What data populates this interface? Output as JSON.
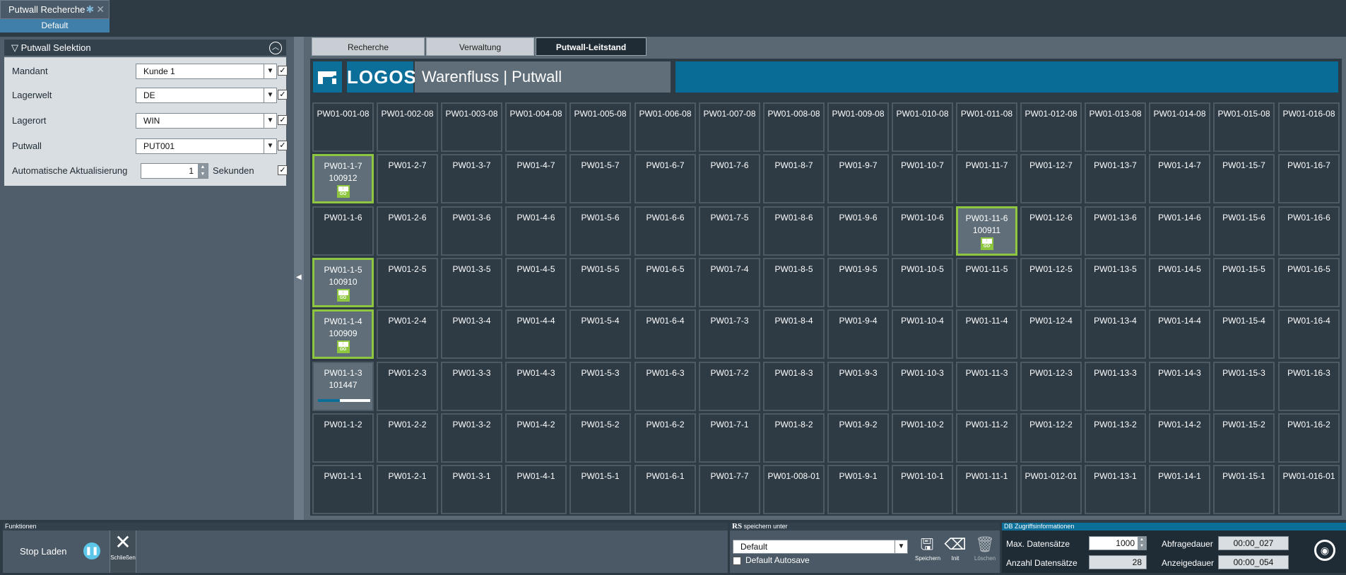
{
  "window": {
    "tab_title": "Putwall Recherche",
    "subtab": "Default"
  },
  "sidebar": {
    "header": "Putwall Selektion",
    "fields": [
      {
        "label": "Mandant",
        "value": "Kunde 1",
        "checked": true
      },
      {
        "label": "Lagerwelt",
        "value": "DE",
        "checked": true
      },
      {
        "label": "Lagerort",
        "value": "WIN",
        "checked": true
      },
      {
        "label": "Putwall",
        "value": "PUT001",
        "checked": true
      }
    ],
    "auto_update": {
      "label": "Automatische Aktualisierung",
      "value": "1",
      "unit": "Sekunden",
      "checked": true
    }
  },
  "main": {
    "tabs": [
      {
        "label": "Recherche",
        "active": false
      },
      {
        "label": "Verwaltung",
        "active": false
      },
      {
        "label": "Putwall-Leitstand",
        "active": true
      }
    ],
    "logo_text": "LOGOS",
    "title": "Warenfluss | Putwall",
    "grid": [
      [
        "PW01-001-08",
        "PW01-002-08",
        "PW01-003-08",
        "PW01-004-08",
        "PW01-005-08",
        "PW01-006-08",
        "PW01-007-08",
        "PW01-008-08",
        "PW01-009-08",
        "PW01-010-08",
        "PW01-011-08",
        "PW01-012-08",
        "PW01-013-08",
        "PW01-014-08",
        "PW01-015-08",
        "PW01-016-08"
      ],
      [
        "PW01-1-7",
        "PW01-2-7",
        "PW01-3-7",
        "PW01-4-7",
        "PW01-5-7",
        "PW01-6-7",
        "PW01-7-6",
        "PW01-8-7",
        "PW01-9-7",
        "PW01-10-7",
        "PW01-11-7",
        "PW01-12-7",
        "PW01-13-7",
        "PW01-14-7",
        "PW01-15-7",
        "PW01-16-7"
      ],
      [
        "PW01-1-6",
        "PW01-2-6",
        "PW01-3-6",
        "PW01-4-6",
        "PW01-5-6",
        "PW01-6-6",
        "PW01-7-5",
        "PW01-8-6",
        "PW01-9-6",
        "PW01-10-6",
        "PW01-11-6",
        "PW01-12-6",
        "PW01-13-6",
        "PW01-14-6",
        "PW01-15-6",
        "PW01-16-6"
      ],
      [
        "PW01-1-5",
        "PW01-2-5",
        "PW01-3-5",
        "PW01-4-5",
        "PW01-5-5",
        "PW01-6-5",
        "PW01-7-4",
        "PW01-8-5",
        "PW01-9-5",
        "PW01-10-5",
        "PW01-11-5",
        "PW01-12-5",
        "PW01-13-5",
        "PW01-14-5",
        "PW01-15-5",
        "PW01-16-5"
      ],
      [
        "PW01-1-4",
        "PW01-2-4",
        "PW01-3-4",
        "PW01-4-4",
        "PW01-5-4",
        "PW01-6-4",
        "PW01-7-3",
        "PW01-8-4",
        "PW01-9-4",
        "PW01-10-4",
        "PW01-11-4",
        "PW01-12-4",
        "PW01-13-4",
        "PW01-14-4",
        "PW01-15-4",
        "PW01-16-4"
      ],
      [
        "PW01-1-3",
        "PW01-2-3",
        "PW01-3-3",
        "PW01-4-3",
        "PW01-5-3",
        "PW01-6-3",
        "PW01-7-2",
        "PW01-8-3",
        "PW01-9-3",
        "PW01-10-3",
        "PW01-11-3",
        "PW01-12-3",
        "PW01-13-3",
        "PW01-14-3",
        "PW01-15-3",
        "PW01-16-3"
      ],
      [
        "PW01-1-2",
        "PW01-2-2",
        "PW01-3-2",
        "PW01-4-2",
        "PW01-5-2",
        "PW01-6-2",
        "PW01-7-1",
        "PW01-8-2",
        "PW01-9-2",
        "PW01-10-2",
        "PW01-11-2",
        "PW01-12-2",
        "PW01-13-2",
        "PW01-14-2",
        "PW01-15-2",
        "PW01-16-2"
      ],
      [
        "PW01-1-1",
        "PW01-2-1",
        "PW01-3-1",
        "PW01-4-1",
        "PW01-5-1",
        "PW01-6-1",
        "PW01-7-7",
        "PW01-008-01",
        "PW01-9-1",
        "PW01-10-1",
        "PW01-11-1",
        "PW01-012-01",
        "PW01-13-1",
        "PW01-14-1",
        "PW01-15-1",
        "PW01-016-01"
      ]
    ],
    "cell_details": [
      {
        "row": 1,
        "col": 0,
        "number": "100912",
        "status": "go"
      },
      {
        "row": 2,
        "col": 10,
        "number": "100911",
        "status": "go"
      },
      {
        "row": 3,
        "col": 0,
        "number": "100910",
        "status": "go"
      },
      {
        "row": 4,
        "col": 0,
        "number": "100909",
        "status": "go"
      },
      {
        "row": 5,
        "col": 0,
        "number": "101447",
        "status": "progress",
        "progress": 0.42
      }
    ],
    "go_label": "GO"
  },
  "functions": {
    "header": "Funktionen",
    "stop_label": "Stop Laden",
    "close_label": "Schließen"
  },
  "rs": {
    "header_prefix": "RS",
    "header": "speichern unter",
    "value": "Default",
    "autosave_label": "Default Autosave",
    "save_label": "Speichern",
    "init_label": "Init",
    "delete_label": "Löschen"
  },
  "db": {
    "header": "DB Zugriffsinformationen",
    "max_label": "Max. Datensätze",
    "max_value": "1000",
    "count_label": "Anzahl Datensätze",
    "count_value": "28",
    "query_label": "Abfragedauer",
    "query_value": "00:00_027",
    "display_label": "Anzeigedauer",
    "display_value": "00:00_054"
  },
  "colors": {
    "accent": "#0c6f99",
    "highlight": "#8ec63f",
    "background": "#2e3b45"
  }
}
